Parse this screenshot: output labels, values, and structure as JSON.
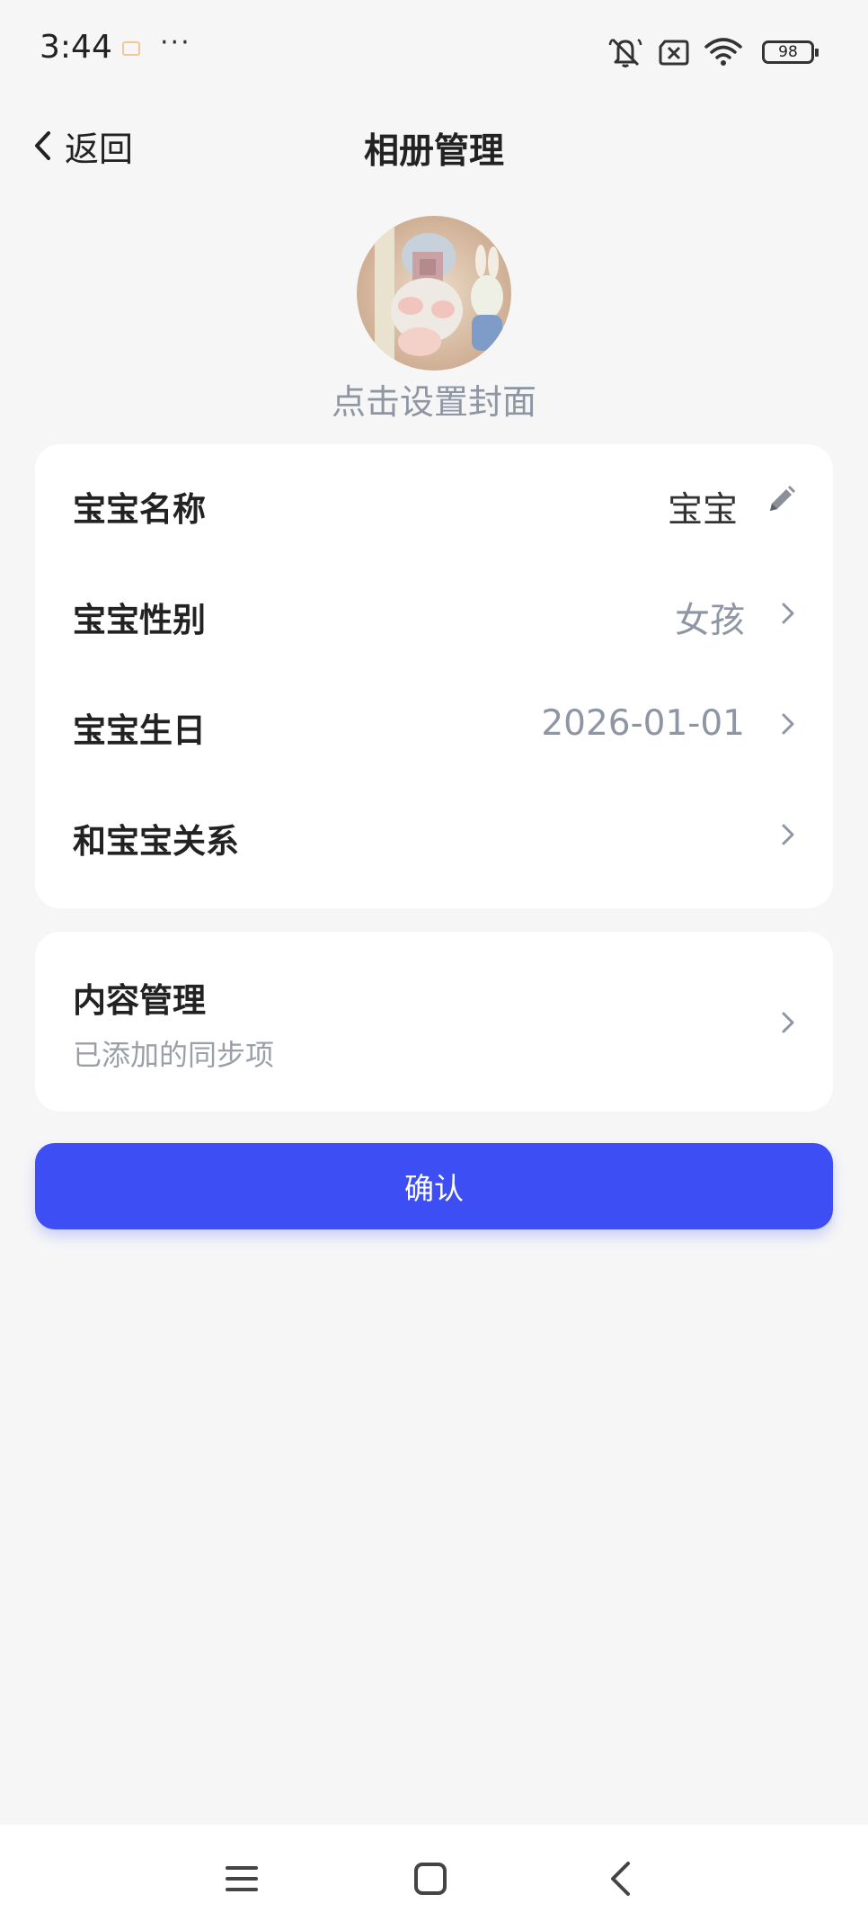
{
  "status_bar": {
    "time": "3:44",
    "more": "···",
    "battery": "98",
    "icons": [
      "app-notification-icon",
      "mute-icon",
      "sim-off-icon",
      "wifi-icon",
      "battery-icon"
    ]
  },
  "header": {
    "back_label": "返回",
    "title": "相册管理"
  },
  "cover": {
    "hint": "点击设置封面"
  },
  "baby_info": {
    "rows": [
      {
        "label": "宝宝名称",
        "value": "宝宝",
        "icon": "pencil-icon"
      },
      {
        "label": "宝宝性别",
        "value": "女孩",
        "icon": "chevron-right-icon"
      },
      {
        "label": "宝宝生日",
        "value": "2026-01-01",
        "icon": "chevron-right-icon"
      },
      {
        "label": "和宝宝关系",
        "value": "",
        "icon": "chevron-right-icon"
      }
    ]
  },
  "content_management": {
    "title": "内容管理",
    "subtitle": "已添加的同步项"
  },
  "confirm_label": "确认",
  "colors": {
    "primary": "#3d4ef5",
    "background": "#f6f6f7",
    "muted_text": "#8e95a3"
  }
}
